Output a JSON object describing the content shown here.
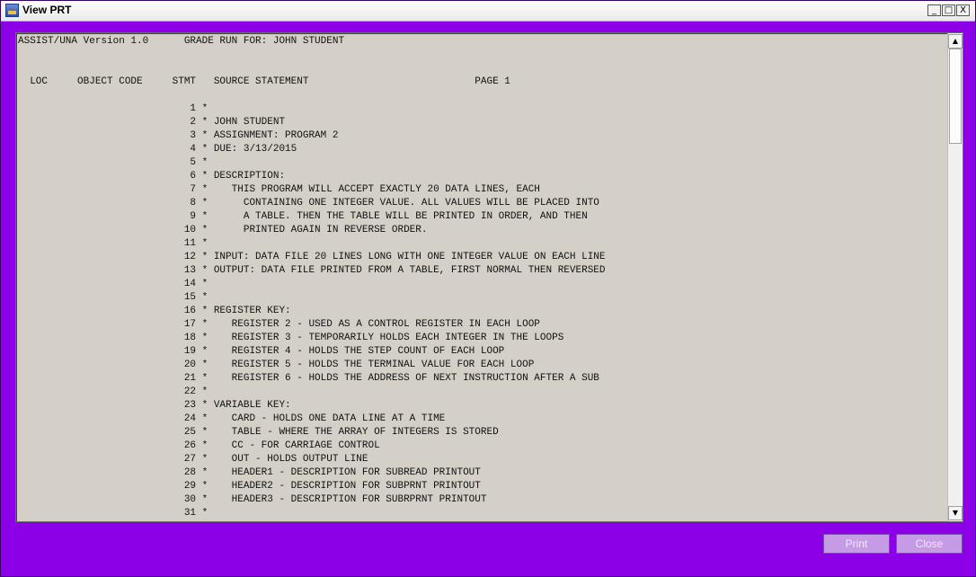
{
  "window": {
    "title": "View PRT",
    "controls": {
      "minimize": "_",
      "maximize": "□",
      "close": "X"
    }
  },
  "report": {
    "header": "ASSIST/UNA Version 1.0      GRADE RUN FOR: JOHN STUDENT",
    "columns": "  LOC     OBJECT CODE     STMT   SOURCE STATEMENT                            PAGE 1",
    "lines": [
      "                             1 *",
      "                             2 * JOHN STUDENT",
      "                             3 * ASSIGNMENT: PROGRAM 2",
      "                             4 * DUE: 3/13/2015",
      "                             5 *",
      "                             6 * DESCRIPTION:",
      "                             7 *    THIS PROGRAM WILL ACCEPT EXACTLY 20 DATA LINES, EACH",
      "                             8 *      CONTAINING ONE INTEGER VALUE. ALL VALUES WILL BE PLACED INTO",
      "                             9 *      A TABLE. THEN THE TABLE WILL BE PRINTED IN ORDER, AND THEN",
      "                            10 *      PRINTED AGAIN IN REVERSE ORDER.",
      "                            11 *",
      "                            12 * INPUT: DATA FILE 20 LINES LONG WITH ONE INTEGER VALUE ON EACH LINE",
      "                            13 * OUTPUT: DATA FILE PRINTED FROM A TABLE, FIRST NORMAL THEN REVERSED",
      "                            14 *",
      "                            15 *",
      "                            16 * REGISTER KEY:",
      "                            17 *    REGISTER 2 - USED AS A CONTROL REGISTER IN EACH LOOP",
      "                            18 *    REGISTER 3 - TEMPORARILY HOLDS EACH INTEGER IN THE LOOPS",
      "                            19 *    REGISTER 4 - HOLDS THE STEP COUNT OF EACH LOOP",
      "                            20 *    REGISTER 5 - HOLDS THE TERMINAL VALUE FOR EACH LOOP",
      "                            21 *    REGISTER 6 - HOLDS THE ADDRESS OF NEXT INSTRUCTION AFTER A SUB",
      "                            22 *",
      "                            23 * VARIABLE KEY:",
      "                            24 *    CARD - HOLDS ONE DATA LINE AT A TIME",
      "                            25 *    TABLE - WHERE THE ARRAY OF INTEGERS IS STORED",
      "                            26 *    CC - FOR CARRIAGE CONTROL",
      "                            27 *    OUT - HOLDS OUTPUT LINE",
      "                            28 *    HEADER1 - DESCRIPTION FOR SUBREAD PRINTOUT",
      "                            29 *    HEADER2 - DESCRIPTION FOR SUBPRNT PRINTOUT",
      "                            30 *    HEADER3 - DESCRIPTION FOR SUBRPRNT PRINTOUT",
      "                            31 *"
    ]
  },
  "buttons": {
    "print": "Print",
    "close": "Close"
  },
  "colors": {
    "frame": "#8b00e6",
    "panel": "#d4d0c8",
    "button": "#c59be6"
  }
}
